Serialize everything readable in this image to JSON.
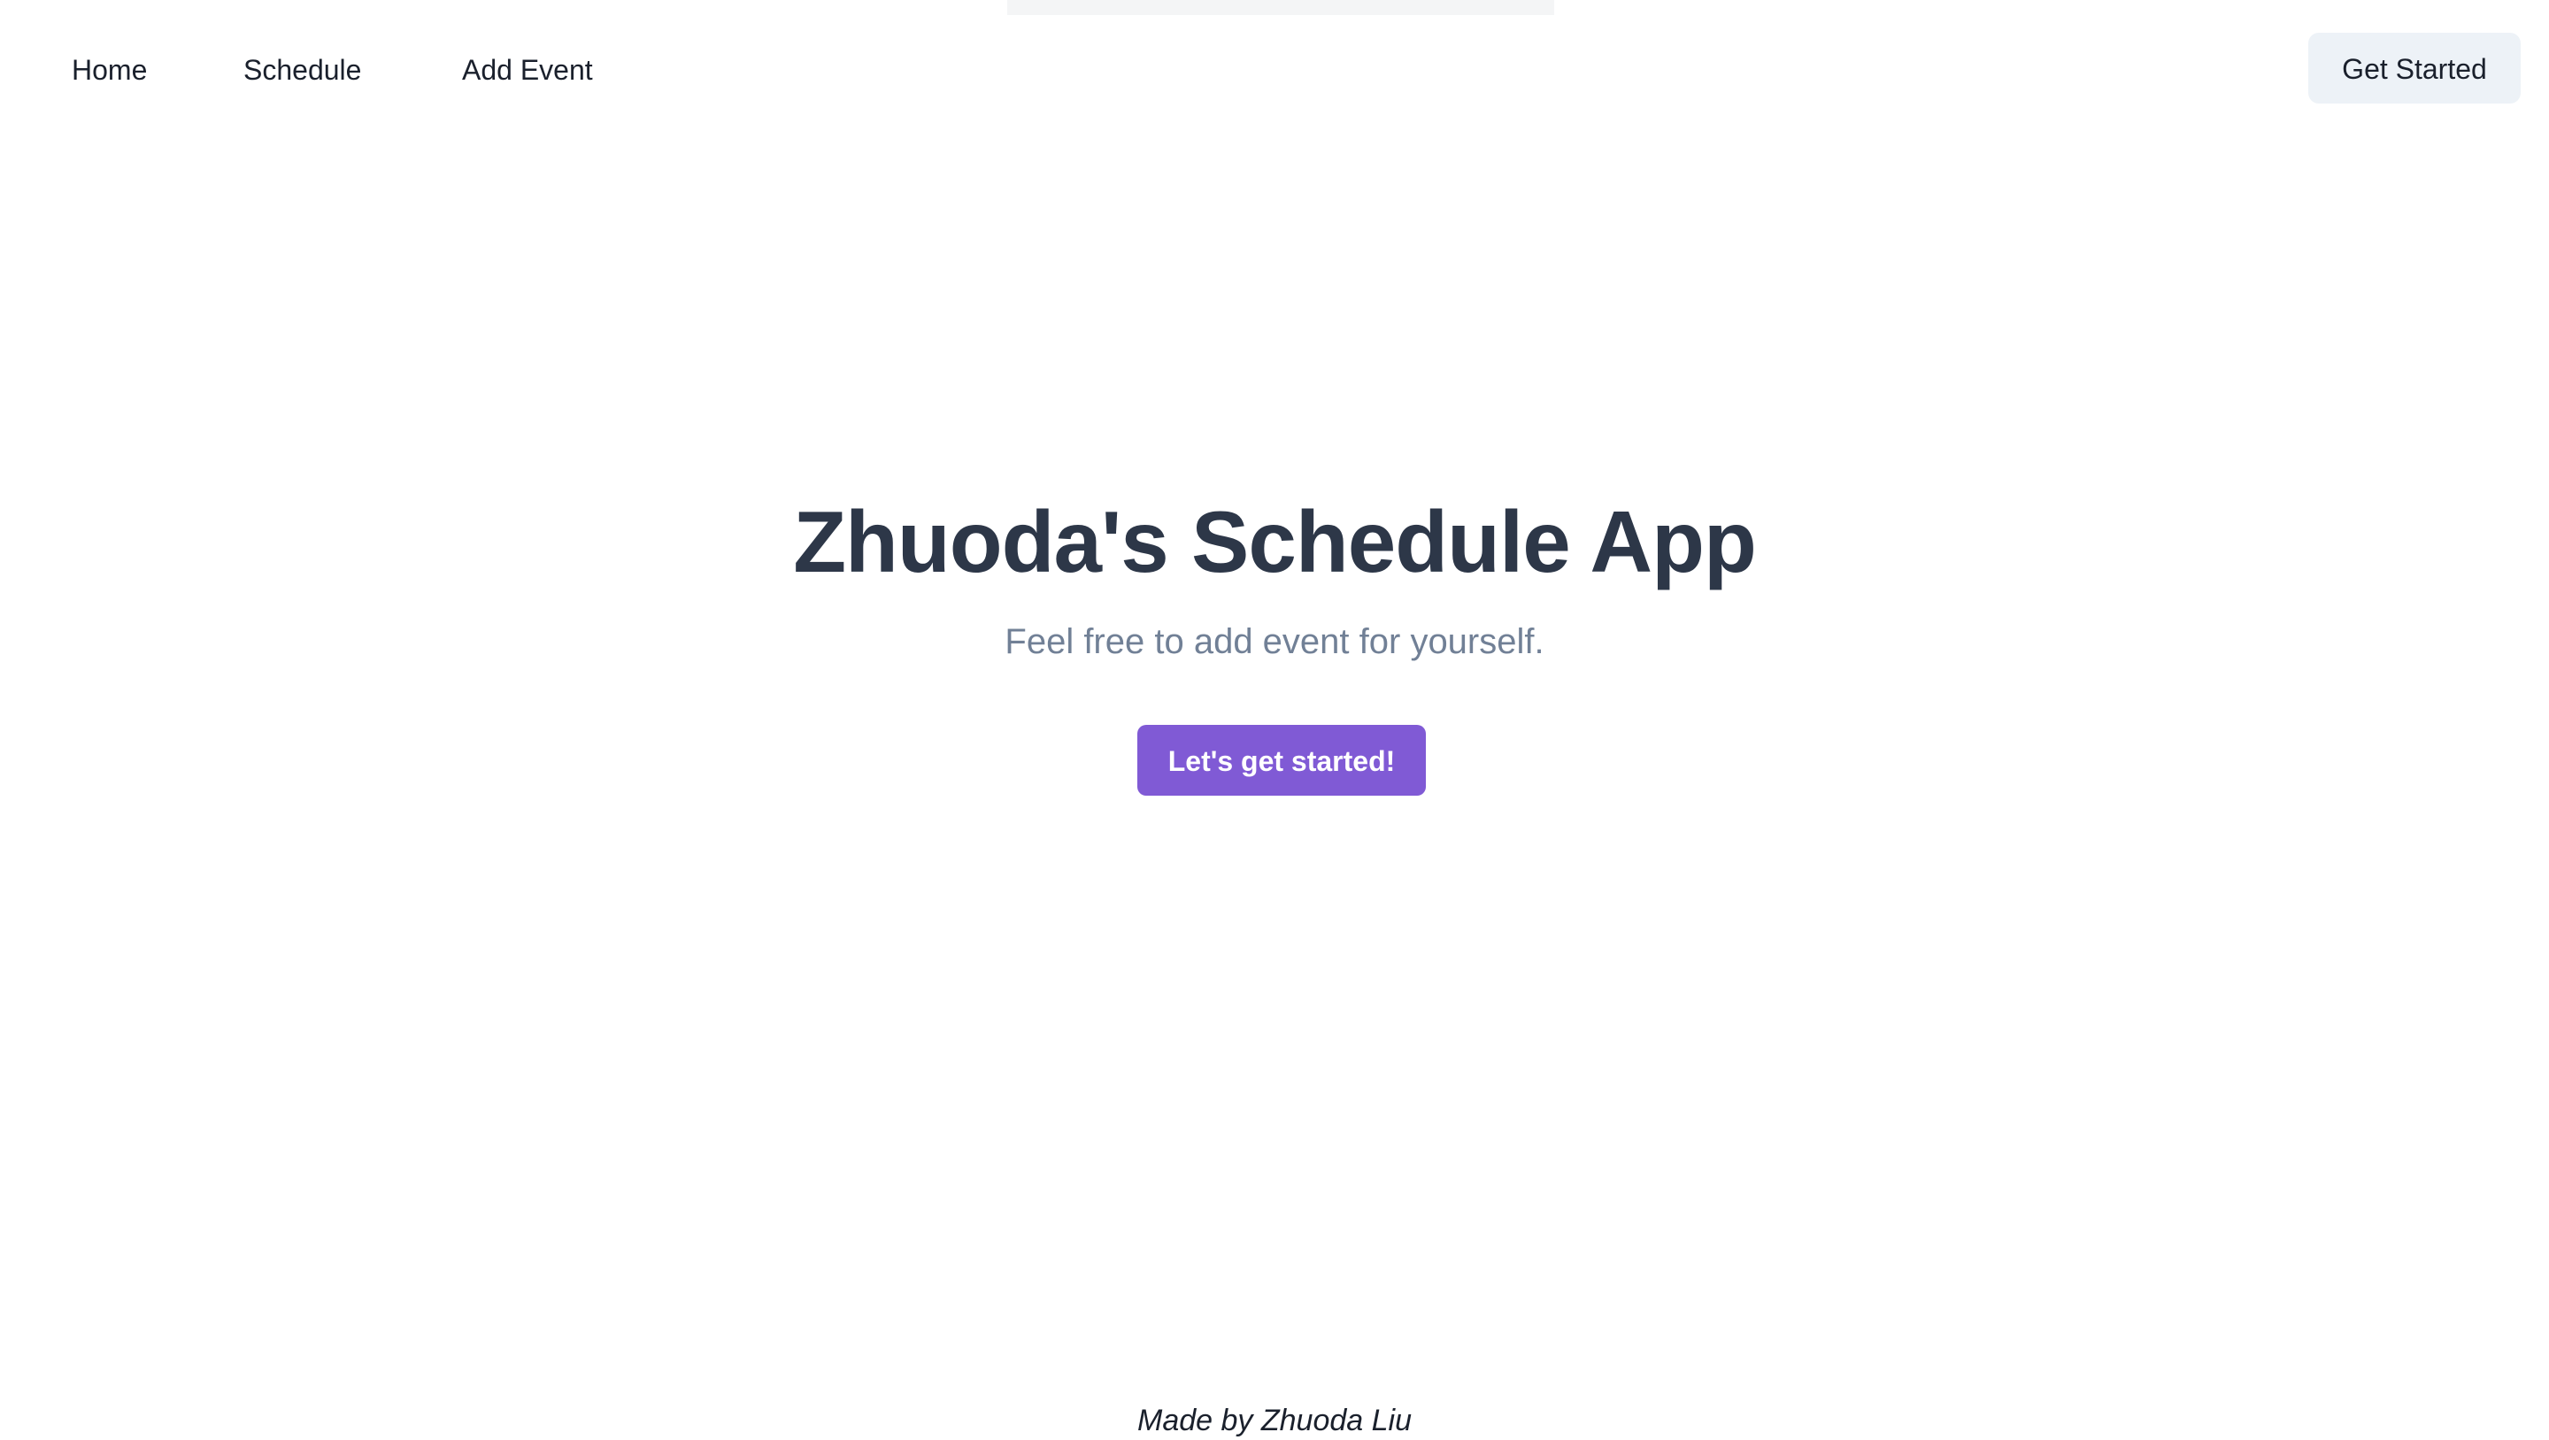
{
  "nav": {
    "links": [
      {
        "label": "Home"
      },
      {
        "label": "Schedule"
      },
      {
        "label": "Add Event"
      }
    ],
    "cta_label": "Get Started"
  },
  "hero": {
    "title": "Zhuoda's Schedule App",
    "subtitle": "Feel free to add event for yourself.",
    "button_label": "Let's get started!"
  },
  "footer": {
    "text": "Made by Zhuoda Liu"
  },
  "colors": {
    "accent": "#805ad5",
    "heading": "#2d3748",
    "muted": "#718096",
    "nav_button_bg": "#edf2f7"
  }
}
